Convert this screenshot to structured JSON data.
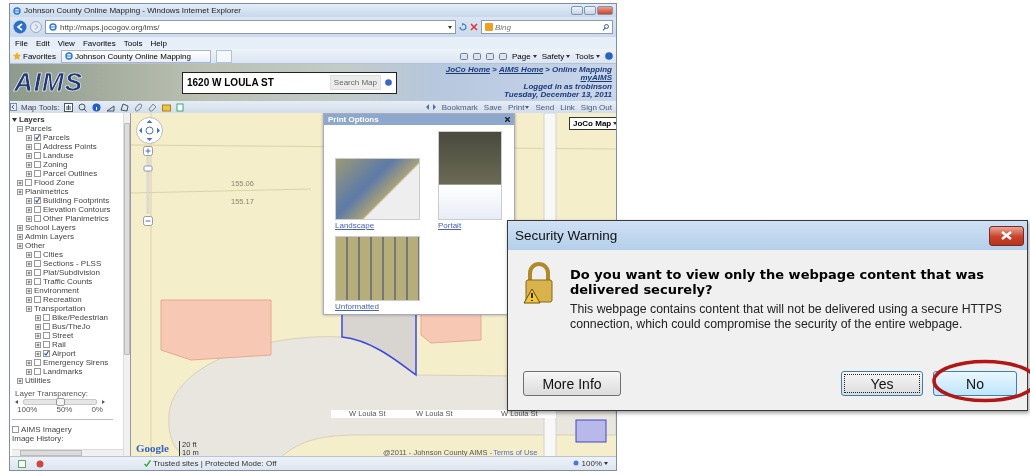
{
  "browser": {
    "title": "Johnson County Online Mapping - Windows Internet Explorer",
    "address": "http://maps.jocogov.org/ims/",
    "search": {
      "placeholder": "Bing"
    },
    "menu": [
      "File",
      "Edit",
      "View",
      "Favorites",
      "Tools",
      "Help"
    ],
    "favorites_button": "Favorites",
    "tab": "Johnson County Online Mapping",
    "commands": [
      "Page",
      "Safety",
      "Tools"
    ]
  },
  "header": {
    "logo": "AIMS",
    "search": {
      "value": "1620 W LOULA ST"
    },
    "search_button": "Search Map",
    "breadcrumb": [
      "JoCo Home",
      "AIMS Home",
      "Online Mapping"
    ],
    "separator": ">",
    "account_link": "myAIMS",
    "login": "Logged in as trobinson",
    "date": "Tuesday, December 13, 2011"
  },
  "toolbar": {
    "label": "Map Tools:",
    "actions": [
      {
        "label": "Bookmark",
        "menu": false
      },
      {
        "label": "Save",
        "menu": false
      },
      {
        "label": "Print",
        "menu": true
      },
      {
        "label": "Send",
        "menu": false
      },
      {
        "label": "Link",
        "menu": false
      },
      {
        "label": "Sign Out",
        "menu": false
      }
    ]
  },
  "layers": {
    "title": "Layers",
    "items": [
      {
        "label": "Parcels",
        "kind": "group",
        "expanded": true,
        "children": [
          {
            "label": "Parcels",
            "kind": "layer",
            "checked": true
          },
          {
            "label": "Address Points",
            "kind": "layer",
            "checked": false
          },
          {
            "label": "Landuse",
            "kind": "layer",
            "checked": false
          },
          {
            "label": "Zoning",
            "kind": "layer",
            "checked": false
          },
          {
            "label": "Parcel Outlines",
            "kind": "layer",
            "checked": false
          }
        ]
      },
      {
        "label": "Flood Zone",
        "kind": "layer",
        "checked": false
      },
      {
        "label": "Planimetrics",
        "kind": "group",
        "expanded": false,
        "children": [
          {
            "label": "Building Footprints",
            "kind": "layer",
            "checked": true
          },
          {
            "label": "Elevation Contours",
            "kind": "layer",
            "checked": false
          },
          {
            "label": "Other Planimetrics",
            "kind": "layer",
            "checked": false
          }
        ]
      },
      {
        "label": "School Layers",
        "kind": "group",
        "expanded": false
      },
      {
        "label": "Admin Layers",
        "kind": "group",
        "expanded": false
      },
      {
        "label": "Other",
        "kind": "group",
        "expanded": false,
        "children": [
          {
            "label": "Cities",
            "kind": "layer",
            "checked": false
          },
          {
            "label": "Sections - PLSS",
            "kind": "layer",
            "checked": false
          },
          {
            "label": "Plat/Subdivision",
            "kind": "layer",
            "checked": false
          },
          {
            "label": "Traffic Counts",
            "kind": "layer",
            "checked": false
          },
          {
            "label": "Environment",
            "kind": "group",
            "expanded": false
          },
          {
            "label": "Recreation",
            "kind": "layer",
            "checked": false
          },
          {
            "label": "Transportation",
            "kind": "group",
            "expanded": false,
            "children": [
              {
                "label": "Bike/Pedestrian",
                "kind": "layer",
                "checked": false
              },
              {
                "label": "Bus/TheJo",
                "kind": "layer",
                "checked": false
              },
              {
                "label": "Street",
                "kind": "layer",
                "checked": false
              },
              {
                "label": "Rail",
                "kind": "layer",
                "checked": false
              },
              {
                "label": "Airport",
                "kind": "layer",
                "checked": true
              }
            ]
          },
          {
            "label": "Emergency Sirens",
            "kind": "layer",
            "checked": false
          },
          {
            "label": "Landmarks",
            "kind": "layer",
            "checked": false
          }
        ]
      },
      {
        "label": "Utilities",
        "kind": "group",
        "expanded": false
      }
    ]
  },
  "transparency": {
    "label": "Layer Transparency:",
    "level": 0.5,
    "ticks": [
      "100%",
      "50%",
      "0%"
    ]
  },
  "imagery": {
    "label": "AIMS Imagery",
    "checked": false
  },
  "history_label": "Image History:",
  "map": {
    "zoom": {
      "level": 0.88
    },
    "labels": [
      "155.06",
      "155.17"
    ],
    "streets": [
      "W Loula St",
      "W Loula St",
      "W Loula St"
    ],
    "map_menu": "JoCo Map",
    "brand": "Google",
    "scale": [
      "20 ft",
      "10 m"
    ],
    "copyright": "@2011 - Johnson County AIMS - ",
    "terms_link": "Terms of Use"
  },
  "print_options": {
    "title": "Print Options",
    "options": [
      {
        "label": "Landscape",
        "kind": "landscape"
      },
      {
        "label": "Portait",
        "kind": "portrait"
      },
      {
        "label": "Unformatted",
        "kind": "unformatted"
      }
    ]
  },
  "status_bar": {
    "zone": "Trusted sites | Protected Mode: Off",
    "zoom": "100%"
  },
  "dialog": {
    "title": "Security Warning",
    "heading": "Do you want to view only the webpage content that was delivered securely?",
    "message": "This webpage contains content that will not be delivered using a secure HTTPS connection, which could compromise the security of the entire webpage.",
    "buttons": [
      {
        "label": "More Info",
        "focused": false,
        "highlighted": false,
        "circled": false
      },
      {
        "label": "Yes",
        "focused": true,
        "highlighted": false,
        "circled": false
      },
      {
        "label": "No",
        "focused": false,
        "highlighted": true,
        "circled": true
      }
    ]
  }
}
